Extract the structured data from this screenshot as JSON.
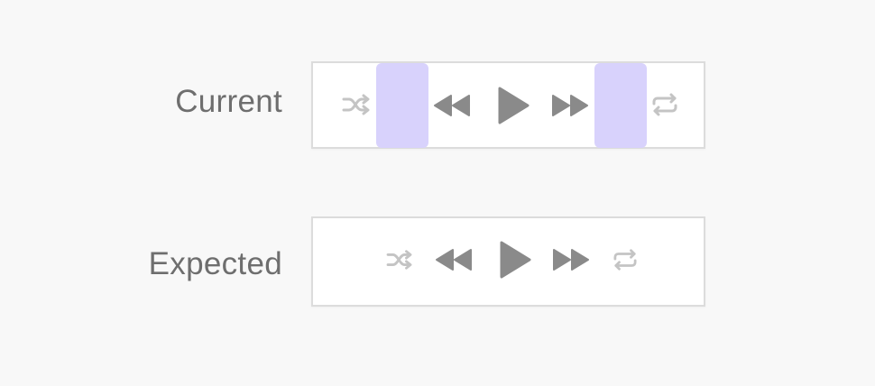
{
  "rows": [
    {
      "label": "Current"
    },
    {
      "label": "Expected"
    }
  ],
  "icons": {
    "shuffle": "shuffle-icon",
    "previous": "rewind-icon",
    "play": "play-icon",
    "next": "fast-forward-icon",
    "repeat": "repeat-icon"
  },
  "colors": {
    "background": "#f8f8f8",
    "box_bg": "#ffffff",
    "box_border": "#dcdcdc",
    "label_text": "#6e6e6e",
    "primary_icon": "#8a8a8a",
    "secondary_icon": "#c4c4c4",
    "gap_highlight": "#d8d2fc"
  }
}
